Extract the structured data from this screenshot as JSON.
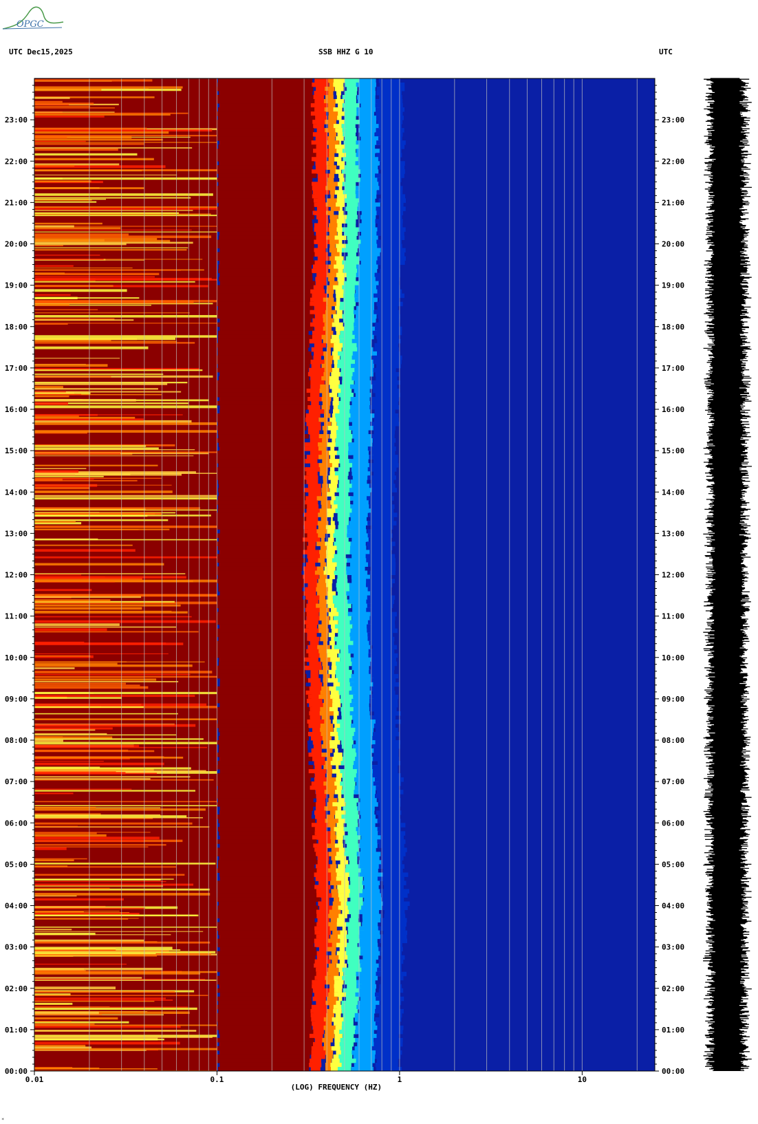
{
  "header": {
    "left": "UTC  Dec15,2025",
    "center": "SSB HHZ G 10",
    "right": "UTC"
  },
  "logo": {
    "text": "OPGC",
    "color": "#3b70a8"
  },
  "footer_mark": "*",
  "chart_data": {
    "type": "heatmap",
    "title": "SSB HHZ G 10",
    "date": "Dec15,2025",
    "xlabel": "(LOG) FREQUENCY (HZ)",
    "ylabel": "UTC",
    "x_scale": "log",
    "xlim": [
      0.01,
      25
    ],
    "x_ticks": [
      "0.01",
      "0.1",
      "1",
      "10"
    ],
    "ylim_hours": [
      0,
      24
    ],
    "y_ticks": [
      "00:00",
      "01:00",
      "02:00",
      "03:00",
      "04:00",
      "05:00",
      "06:00",
      "07:00",
      "08:00",
      "09:00",
      "10:00",
      "11:00",
      "12:00",
      "13:00",
      "14:00",
      "15:00",
      "16:00",
      "17:00",
      "18:00",
      "19:00",
      "20:00",
      "21:00",
      "22:00",
      "23:00"
    ],
    "colormap": [
      "#00007a",
      "#0030c8",
      "#00a0ff",
      "#40ffc0",
      "#ffff40",
      "#ff8000",
      "#ff2000",
      "#8b0000"
    ],
    "background_low_freq": "#8b0000",
    "background_high_freq": "#0a1fa6",
    "microseism_peak_hz": [
      {
        "hour": 0,
        "hz": 0.45
      },
      {
        "hour": 4,
        "hz": 0.5
      },
      {
        "hour": 8,
        "hz": 0.45
      },
      {
        "hour": 12,
        "hz": 0.42
      },
      {
        "hour": 16,
        "hz": 0.44
      },
      {
        "hour": 20,
        "hz": 0.48
      },
      {
        "hour": 24,
        "hz": 0.47
      }
    ],
    "gridlines_hz": [
      0.02,
      0.03,
      0.04,
      0.05,
      0.06,
      0.07,
      0.08,
      0.09,
      0.1,
      0.2,
      0.3,
      0.4,
      0.5,
      0.6,
      0.7,
      0.8,
      0.9,
      1,
      2,
      3,
      4,
      5,
      6,
      7,
      8,
      9,
      10,
      20
    ],
    "seismogram": {
      "color": "#000000"
    }
  }
}
